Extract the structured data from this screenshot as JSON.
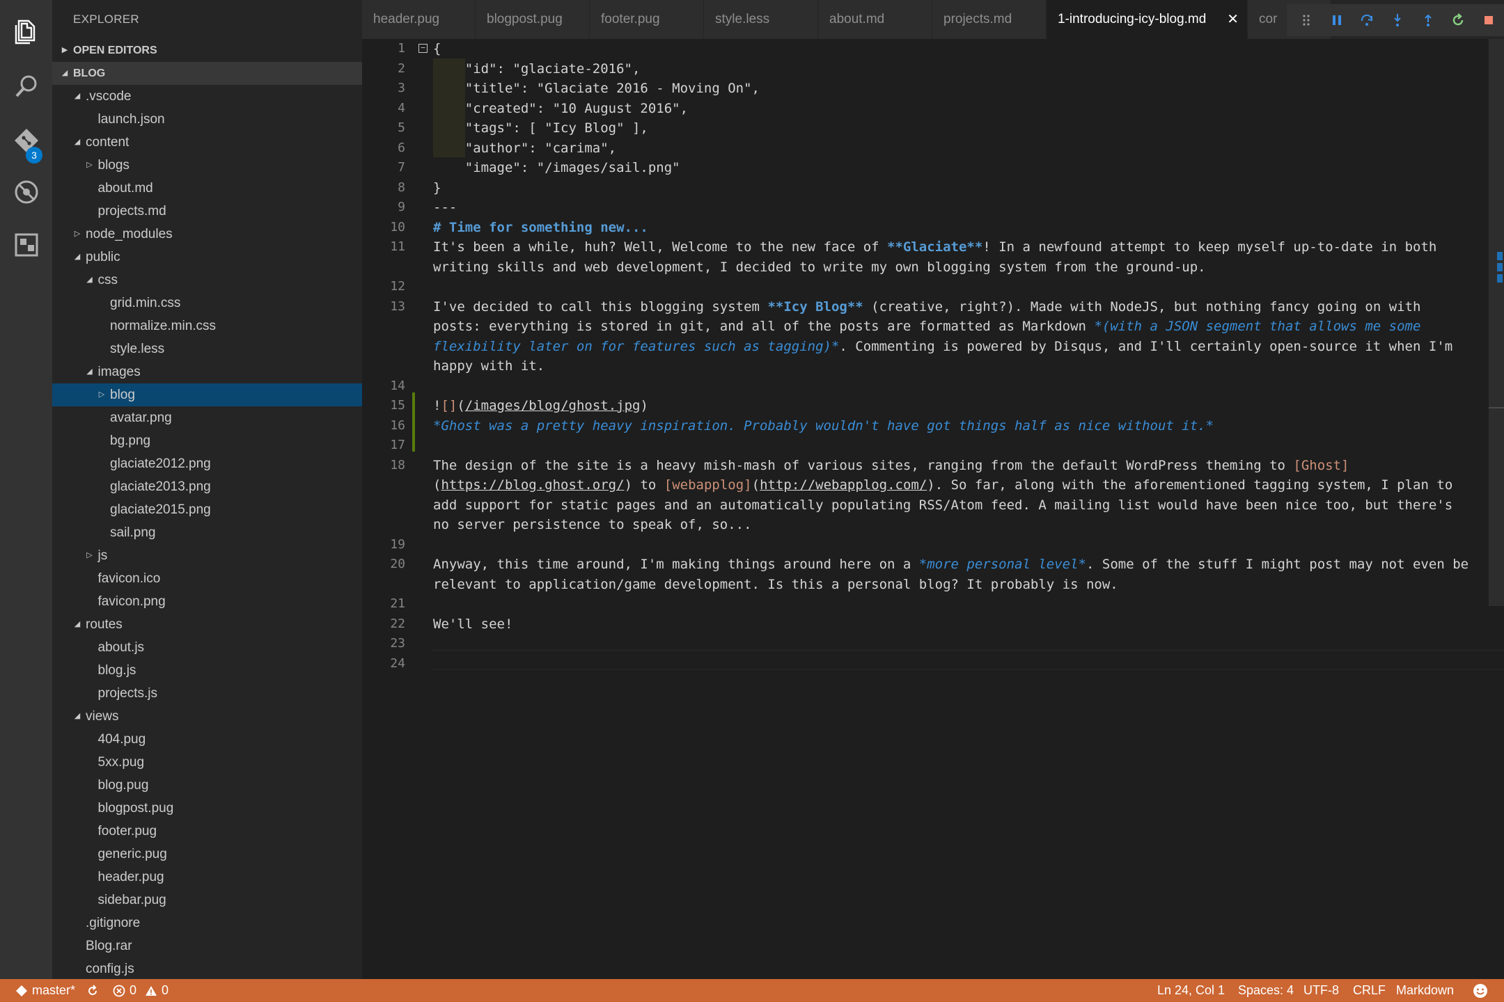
{
  "sidebar": {
    "title": "EXPLORER",
    "open_editors": "OPEN EDITORS",
    "folder": "BLOG",
    "tree": [
      {
        "label": ".vscode",
        "depth": 0,
        "type": "folder",
        "expanded": true
      },
      {
        "label": "launch.json",
        "depth": 1,
        "type": "file"
      },
      {
        "label": "content",
        "depth": 0,
        "type": "folder",
        "expanded": true
      },
      {
        "label": "blogs",
        "depth": 1,
        "type": "folder",
        "expanded": false
      },
      {
        "label": "about.md",
        "depth": 1,
        "type": "file"
      },
      {
        "label": "projects.md",
        "depth": 1,
        "type": "file"
      },
      {
        "label": "node_modules",
        "depth": 0,
        "type": "folder",
        "expanded": false
      },
      {
        "label": "public",
        "depth": 0,
        "type": "folder",
        "expanded": true
      },
      {
        "label": "css",
        "depth": 1,
        "type": "folder",
        "expanded": true
      },
      {
        "label": "grid.min.css",
        "depth": 2,
        "type": "file"
      },
      {
        "label": "normalize.min.css",
        "depth": 2,
        "type": "file"
      },
      {
        "label": "style.less",
        "depth": 2,
        "type": "file"
      },
      {
        "label": "images",
        "depth": 1,
        "type": "folder",
        "expanded": true
      },
      {
        "label": "blog",
        "depth": 2,
        "type": "folder",
        "expanded": false,
        "selected": true
      },
      {
        "label": "avatar.png",
        "depth": 2,
        "type": "file"
      },
      {
        "label": "bg.png",
        "depth": 2,
        "type": "file"
      },
      {
        "label": "glaciate2012.png",
        "depth": 2,
        "type": "file"
      },
      {
        "label": "glaciate2013.png",
        "depth": 2,
        "type": "file"
      },
      {
        "label": "glaciate2015.png",
        "depth": 2,
        "type": "file"
      },
      {
        "label": "sail.png",
        "depth": 2,
        "type": "file"
      },
      {
        "label": "js",
        "depth": 1,
        "type": "folder",
        "expanded": false
      },
      {
        "label": "favicon.ico",
        "depth": 1,
        "type": "file"
      },
      {
        "label": "favicon.png",
        "depth": 1,
        "type": "file"
      },
      {
        "label": "routes",
        "depth": 0,
        "type": "folder",
        "expanded": true
      },
      {
        "label": "about.js",
        "depth": 1,
        "type": "file"
      },
      {
        "label": "blog.js",
        "depth": 1,
        "type": "file"
      },
      {
        "label": "projects.js",
        "depth": 1,
        "type": "file"
      },
      {
        "label": "views",
        "depth": 0,
        "type": "folder",
        "expanded": true
      },
      {
        "label": "404.pug",
        "depth": 1,
        "type": "file"
      },
      {
        "label": "5xx.pug",
        "depth": 1,
        "type": "file"
      },
      {
        "label": "blog.pug",
        "depth": 1,
        "type": "file"
      },
      {
        "label": "blogpost.pug",
        "depth": 1,
        "type": "file"
      },
      {
        "label": "footer.pug",
        "depth": 1,
        "type": "file"
      },
      {
        "label": "generic.pug",
        "depth": 1,
        "type": "file"
      },
      {
        "label": "header.pug",
        "depth": 1,
        "type": "file"
      },
      {
        "label": "sidebar.pug",
        "depth": 1,
        "type": "file"
      },
      {
        "label": ".gitignore",
        "depth": 0,
        "type": "file"
      },
      {
        "label": "Blog.rar",
        "depth": 0,
        "type": "file"
      },
      {
        "label": "config.js",
        "depth": 0,
        "type": "file"
      }
    ]
  },
  "activity": {
    "scm_badge": "3",
    "icons": [
      "files-icon",
      "search-icon",
      "git-icon",
      "debug-icon",
      "extensions-icon"
    ]
  },
  "tabs": [
    {
      "label": "header.pug",
      "active": false
    },
    {
      "label": "blogpost.pug",
      "active": false
    },
    {
      "label": "footer.pug",
      "active": false
    },
    {
      "label": "style.less",
      "active": false
    },
    {
      "label": "about.md",
      "active": false
    },
    {
      "label": "projects.md",
      "active": false
    },
    {
      "label": "1-introducing-icy-blog.md",
      "active": true
    },
    {
      "label": "cor",
      "active": false
    }
  ],
  "tab_close_glyph": "✕",
  "debug_toolbar": [
    "drag-handle-icon",
    "pause-icon",
    "step-over-icon",
    "step-into-icon",
    "step-out-icon",
    "restart-icon",
    "stop-icon"
  ],
  "editor": {
    "line_numbers": [
      "1",
      "2",
      "3",
      "4",
      "5",
      "6",
      "7",
      "8",
      "9",
      "10",
      "11",
      "12",
      "13",
      "14",
      "15",
      "16",
      "17",
      "18",
      "19",
      "20",
      "21",
      "22",
      "23",
      "24"
    ],
    "lines": [
      {
        "n": 1,
        "parts": [
          [
            "plain",
            "{"
          ]
        ]
      },
      {
        "n": 2,
        "parts": [
          [
            "plain",
            "    \"id\": \"glaciate-2016\","
          ]
        ]
      },
      {
        "n": 3,
        "parts": [
          [
            "plain",
            "    \"title\": \"Glaciate 2016 - Moving On\","
          ]
        ]
      },
      {
        "n": 4,
        "parts": [
          [
            "plain",
            "    \"created\": \"10 August 2016\","
          ]
        ]
      },
      {
        "n": 5,
        "parts": [
          [
            "plain",
            "    \"tags\": [ \"Icy Blog\" ],"
          ]
        ]
      },
      {
        "n": 6,
        "parts": [
          [
            "plain",
            "    \"author\": \"carima\","
          ]
        ]
      },
      {
        "n": 7,
        "parts": [
          [
            "plain",
            "    \"image\": \"/images/sail.png\""
          ]
        ]
      },
      {
        "n": 8,
        "parts": [
          [
            "plain",
            "}"
          ]
        ]
      },
      {
        "n": 9,
        "parts": [
          [
            "plain",
            "---"
          ]
        ]
      },
      {
        "n": 10,
        "parts": [
          [
            "heading",
            "# Time for something new..."
          ]
        ]
      },
      {
        "n": 11,
        "parts": [
          [
            "plain",
            "It's been a while, huh? Well, Welcome to the new face of "
          ],
          [
            "bold",
            "**Glaciate**"
          ],
          [
            "plain",
            "! In a newfound attempt to keep myself up-to-date in both"
          ]
        ]
      },
      {
        "n": null,
        "parts": [
          [
            "plain",
            "writing skills and web development, I decided to write my own blogging system from the ground-up."
          ]
        ]
      },
      {
        "n": 12,
        "parts": []
      },
      {
        "n": 13,
        "parts": [
          [
            "plain",
            "I've decided to call this blogging system "
          ],
          [
            "bold",
            "**Icy Blog**"
          ],
          [
            "plain",
            " (creative, right?). Made with NodeJS, but nothing fancy going on with"
          ]
        ]
      },
      {
        "n": null,
        "parts": [
          [
            "plain",
            "posts: everything is stored in git, and all of the posts are formatted as Markdown "
          ],
          [
            "ital",
            "*(with a JSON segment that allows me some"
          ]
        ]
      },
      {
        "n": null,
        "parts": [
          [
            "ital",
            "flexibility later on for features such as tagging)*"
          ],
          [
            "plain",
            ". Commenting is powered by Disqus, and I'll certainly open-source it when I'm"
          ]
        ]
      },
      {
        "n": null,
        "parts": [
          [
            "plain",
            "happy with it."
          ]
        ]
      },
      {
        "n": 14,
        "parts": []
      },
      {
        "n": 15,
        "parts": [
          [
            "plain",
            "!"
          ],
          [
            "link",
            "[]"
          ],
          [
            "plain",
            "("
          ],
          [
            "url",
            "/images/blog/ghost.jpg"
          ],
          [
            "plain",
            ")"
          ]
        ]
      },
      {
        "n": 16,
        "parts": [
          [
            "ital",
            "*Ghost was a pretty heavy inspiration. Probably wouldn't have got things half as nice without it.*"
          ]
        ]
      },
      {
        "n": 17,
        "parts": []
      },
      {
        "n": 18,
        "parts": [
          [
            "plain",
            "The design of the site is a heavy mish-mash of various sites, ranging from the default WordPress theming to "
          ],
          [
            "link",
            "[Ghost]"
          ]
        ]
      },
      {
        "n": null,
        "parts": [
          [
            "plain",
            "("
          ],
          [
            "url",
            "https://blog.ghost.org/"
          ],
          [
            "plain",
            ") to "
          ],
          [
            "link",
            "[webapplog]"
          ],
          [
            "plain",
            "("
          ],
          [
            "url",
            "http://webapplog.com/"
          ],
          [
            "plain",
            "). So far, along with the aforementioned tagging system, I plan to"
          ]
        ]
      },
      {
        "n": null,
        "parts": [
          [
            "plain",
            "add support for static pages and an automatically populating RSS/Atom feed. A mailing list would have been nice too, but there's"
          ]
        ]
      },
      {
        "n": null,
        "parts": [
          [
            "plain",
            "no server persistence to speak of, so..."
          ]
        ]
      },
      {
        "n": 19,
        "parts": []
      },
      {
        "n": 20,
        "parts": [
          [
            "plain",
            "Anyway, this time around, I'm making things around here on a "
          ],
          [
            "ital",
            "*more personal level*"
          ],
          [
            "plain",
            ". Some of the stuff I might post may not even be"
          ]
        ]
      },
      {
        "n": null,
        "parts": [
          [
            "plain",
            "relevant to application/game development. Is this a personal blog? It probably is now."
          ]
        ]
      },
      {
        "n": 21,
        "parts": []
      },
      {
        "n": 22,
        "parts": [
          [
            "plain",
            "We'll see!"
          ]
        ]
      },
      {
        "n": 23,
        "parts": []
      },
      {
        "n": 24,
        "parts": []
      }
    ]
  },
  "statusbar": {
    "branch": "master*",
    "errors": "0",
    "warnings": "0",
    "position": "Ln 24, Col 1",
    "spaces": "Spaces: 4",
    "encoding": "UTF-8",
    "eol": "CRLF",
    "language": "Markdown"
  },
  "colors": {
    "activity_bar": "#333333",
    "sidebar": "#252526",
    "selection": "#094771",
    "statusbar": "#cc6633",
    "accent": "#007acc",
    "markdown_heading": "#569cd6",
    "markdown_link": "#ce9178",
    "diff_added": "#587c0c"
  }
}
